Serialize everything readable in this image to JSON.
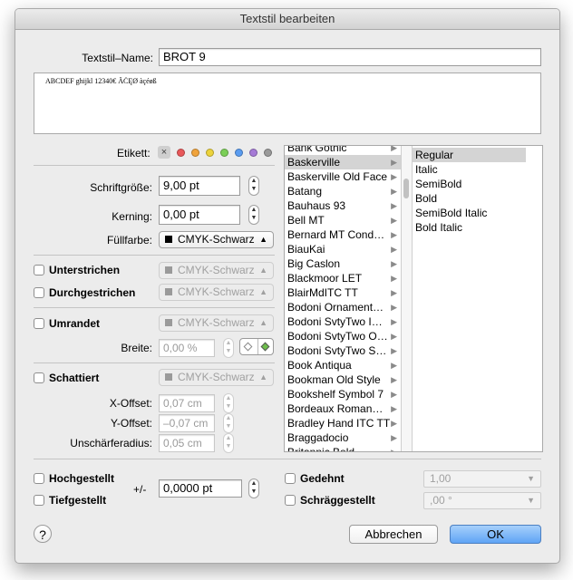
{
  "window": {
    "title": "Textstil bearbeiten"
  },
  "name": {
    "label": "Textstil–Name:",
    "value": "BROT 9"
  },
  "preview": {
    "text": "ABCDEF ghijkl 12340€ ÄĊĘØ àçéøß"
  },
  "label_row": {
    "label": "Etikett:",
    "clear": "×",
    "colors": [
      "#e8585a",
      "#f0a33b",
      "#ecd33c",
      "#7bcf57",
      "#5a9cf0",
      "#a57ad6",
      "#9a9a9a"
    ]
  },
  "fontsize": {
    "label": "Schriftgröße:",
    "value": "9,00 pt"
  },
  "kerning": {
    "label": "Kerning:",
    "value": "0,00 pt"
  },
  "fill": {
    "label": "Füllfarbe:",
    "value": "CMYK-Schwarz",
    "swatch": "#000000"
  },
  "underline": {
    "label": "Unterstrichen",
    "value": "CMYK-Schwarz"
  },
  "strike": {
    "label": "Durchgestrichen",
    "value": "CMYK-Schwarz"
  },
  "outline": {
    "label": "Umrandet",
    "value": "CMYK-Schwarz",
    "width_label": "Breite:",
    "width_value": "0,00 %"
  },
  "shadow": {
    "label": "Schattiert",
    "value": "CMYK-Schwarz",
    "x_label": "X-Offset:",
    "x_value": "0,07 cm",
    "y_label": "Y-Offset:",
    "y_value": "–0,07 cm",
    "blur_label": "Unschärferadius:",
    "blur_value": "0,05 cm"
  },
  "fonts": {
    "selected": "Baskerville",
    "items": [
      "Bank Gothic",
      "Baskerville",
      "Baskerville Old Face",
      "Batang",
      "Bauhaus 93",
      "Bell MT",
      "Bernard MT Cond…",
      "BiauKai",
      "Big Caslon",
      "Blackmoor LET",
      "BlairMdITC TT",
      "Bodoni Ornament…",
      "Bodoni SvtyTwo I…",
      "Bodoni SvtyTwo O…",
      "Bodoni SvtyTwo S…",
      "Book Antiqua",
      "Bookman Old Style",
      "Bookshelf Symbol 7",
      "Bordeaux Roman…",
      "Bradley Hand ITC TT",
      "Braggadocio",
      "Britannic Bold"
    ]
  },
  "styles": {
    "selected": "Regular",
    "items": [
      "Regular",
      "Italic",
      "SemiBold",
      "Bold",
      "SemiBold Italic",
      "Bold Italic"
    ]
  },
  "superscript": {
    "label": "Hochgestellt"
  },
  "subscript": {
    "label": "Tiefgestellt"
  },
  "offset": {
    "label": "+/-",
    "value": "0,0000 pt"
  },
  "stretched": {
    "label": "Gedehnt",
    "value": "1,00"
  },
  "slanted": {
    "label": "Schräggestellt",
    "value": ",00 °"
  },
  "buttons": {
    "help": "?",
    "cancel": "Abbrechen",
    "ok": "OK"
  }
}
